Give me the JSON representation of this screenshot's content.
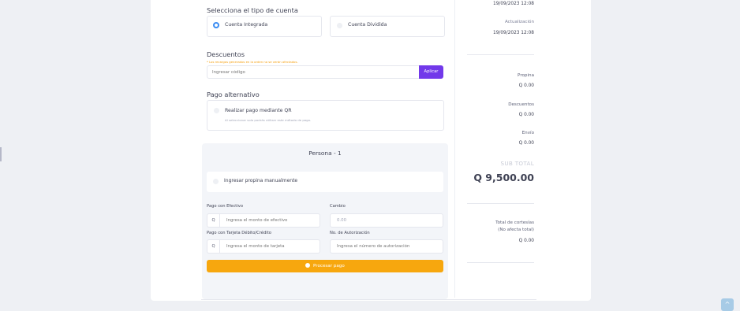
{
  "account_type": {
    "heading": "Selecciona el tipo de cuenta",
    "options": [
      {
        "label": "Cuenta Integrada",
        "selected": true
      },
      {
        "label": "Cuenta Dividida",
        "selected": false
      }
    ]
  },
  "discounts": {
    "heading": "Descuentos",
    "note": "* Los recargos generados en la orden no se verán afectados.",
    "placeholder": "Ingresar código",
    "apply_label": "Aplicar"
  },
  "alt_payment": {
    "heading": "Pago alternativo",
    "option_label": "Realizar pago mediante QR",
    "option_hint": "Al seleccionar solo podrás utilizar este método de pago."
  },
  "person_panel": {
    "title": "Persona - 1",
    "tip_label": "Ingresar propina manualmente",
    "cash_label": "Pago con Efectivo",
    "currency_prefix": "Q",
    "cash_placeholder": "Ingresa el monto de efectivo",
    "change_label": "Cambio",
    "change_value": "0.00",
    "card_label": "Pago con Tarjeta Débito/Crédito",
    "card_placeholder": "Ingresa el monto de tarjeta",
    "auth_label": "No. de Autorización",
    "auth_placeholder": "Ingresa el número de autorización",
    "process_label": "Procesar pago"
  },
  "summary": {
    "created_date": "19/09/2023 12:08",
    "updated_label": "Actualización",
    "updated_date": "19/09/2023 12:08",
    "tip_label": "Propina",
    "tip_value": "Q 0.00",
    "discount_label": "Descuentos",
    "discount_value": "Q 0.00",
    "shipping_label": "Envío",
    "shipping_value": "Q 0.00",
    "subtotal_label": "SUB TOTAL",
    "subtotal_value": "Q 9,500.00",
    "courtesy_label_line1": "Total de cortesías",
    "courtesy_label_line2": "(No afecta total)",
    "courtesy_value": "Q 0.00"
  },
  "colors": {
    "accent_purple": "#7239ea",
    "accent_orange": "#f7a70e",
    "radio_blue": "#3b8cf2"
  }
}
